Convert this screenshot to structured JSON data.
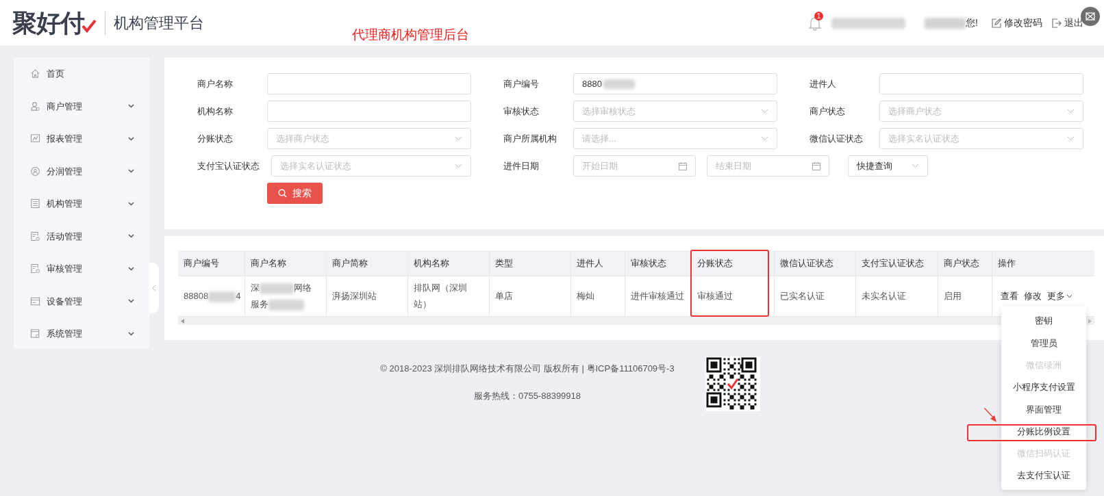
{
  "header": {
    "logo": "聚好付",
    "platform_title": "机构管理平台",
    "annotation": "代理商机构管理后台",
    "notification_count": "1",
    "welcome": "您!",
    "change_password": "修改密码",
    "logout": "退出"
  },
  "sidebar": {
    "items": [
      {
        "label": "首页",
        "expandable": false
      },
      {
        "label": "商户管理",
        "expandable": true
      },
      {
        "label": "报表管理",
        "expandable": true
      },
      {
        "label": "分润管理",
        "expandable": true
      },
      {
        "label": "机构管理",
        "expandable": true
      },
      {
        "label": "活动管理",
        "expandable": true
      },
      {
        "label": "审核管理",
        "expandable": true
      },
      {
        "label": "设备管理",
        "expandable": true
      },
      {
        "label": "系统管理",
        "expandable": true
      }
    ]
  },
  "filters": {
    "rows": [
      [
        {
          "label": "商户名称",
          "kind": "input"
        },
        {
          "label": "商户编号",
          "kind": "input",
          "value": "8880"
        },
        {
          "label": "进件人",
          "kind": "input"
        }
      ],
      [
        {
          "label": "机构名称",
          "kind": "input"
        },
        {
          "label": "审核状态",
          "kind": "select",
          "placeholder": "选择审核状态"
        },
        {
          "label": "商户状态",
          "kind": "select",
          "placeholder": "选择商户状态"
        }
      ],
      [
        {
          "label": "分账状态",
          "kind": "select",
          "placeholder": "选择商户状态"
        },
        {
          "label": "商户所属机构",
          "kind": "select",
          "placeholder": "请选择..."
        },
        {
          "label": "微信认证状态",
          "kind": "select",
          "placeholder": "选择实名认证状态"
        }
      ],
      [
        {
          "label": "支付宝认证状态",
          "kind": "select",
          "placeholder": "选择实名认证状态"
        },
        {
          "label": "进件日期",
          "kind": "daterange",
          "start_placeholder": "开始日期",
          "end_placeholder": "结束日期",
          "quick": "快捷查询"
        }
      ]
    ],
    "search_button": "搜索"
  },
  "table": {
    "columns": [
      {
        "label": "商户编号",
        "highlighted": false
      },
      {
        "label": "商户名称",
        "highlighted": false
      },
      {
        "label": "商户简称",
        "highlighted": false
      },
      {
        "label": "机构名称",
        "highlighted": false
      },
      {
        "label": "类型",
        "highlighted": false
      },
      {
        "label": "进件人",
        "highlighted": false
      },
      {
        "label": "审核状态",
        "highlighted": false
      },
      {
        "label": "分账状态",
        "highlighted": true
      },
      {
        "label": "微信认证状态",
        "highlighted": false
      },
      {
        "label": "支付宝认证状态",
        "highlighted": false
      },
      {
        "label": "商户状态",
        "highlighted": false
      },
      {
        "label": "操作",
        "highlighted": false
      }
    ],
    "rows": [
      {
        "cells": [
          [
            "88808",
            "4"
          ],
          [
            "深",
            "网络",
            "服务"
          ],
          "湃扬深圳站",
          "排队网（深圳站）",
          "单店",
          "梅灿",
          "进件审核通过",
          "审核通过",
          "已实名认证",
          "未实名认证",
          "启用"
        ],
        "actions": [
          "查看",
          "修改",
          "更多"
        ]
      }
    ]
  },
  "more_menu": {
    "items": [
      {
        "label": "密钥",
        "disabled": false,
        "highlighted": false
      },
      {
        "label": "管理员",
        "disabled": false,
        "highlighted": false
      },
      {
        "label": "微信绿洲",
        "disabled": true,
        "highlighted": false
      },
      {
        "label": "小程序支付设置",
        "disabled": false,
        "highlighted": false
      },
      {
        "label": "界面管理",
        "disabled": false,
        "highlighted": false
      },
      {
        "label": "分账比例设置",
        "disabled": false,
        "highlighted": true
      },
      {
        "label": "微信扫码认证",
        "disabled": true,
        "highlighted": false
      },
      {
        "label": "去支付宝认证",
        "disabled": false,
        "highlighted": false
      }
    ]
  },
  "footer": {
    "copyright": "© 2018-2023 深圳排队网络技术有限公司 版权所有 | 粤ICP备11106709号-3",
    "hotline": "服务热线：0755-88399918"
  }
}
